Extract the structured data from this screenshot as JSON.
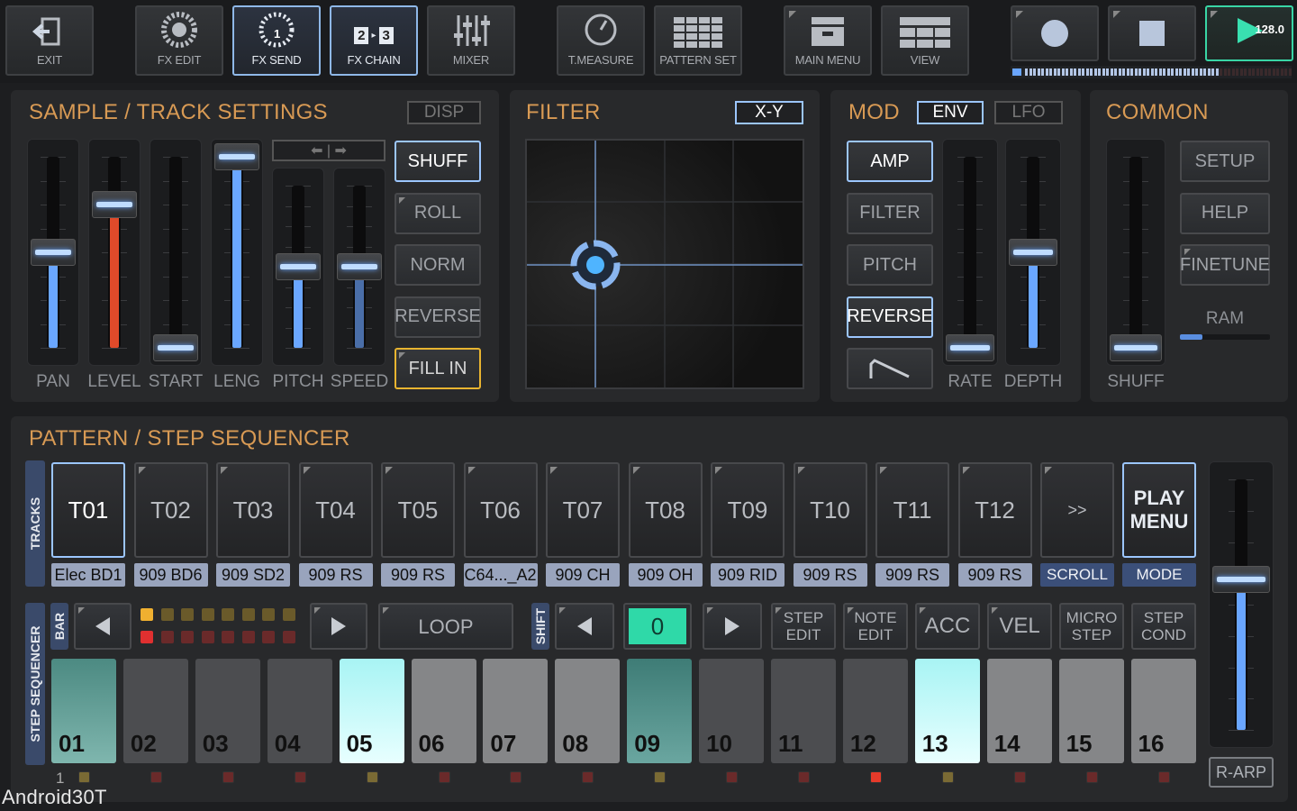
{
  "toolbar": {
    "buttons": [
      {
        "label": "EXIT",
        "icon": "exit-icon"
      },
      {
        "label": "FX EDIT",
        "icon": "fx-edit-icon"
      },
      {
        "label": "FX SEND",
        "icon": "fx-send-icon"
      },
      {
        "label": "FX CHAIN",
        "icon": "fx-chain-icon",
        "chain_a": "2",
        "chain_b": "3"
      },
      {
        "label": "MIXER",
        "icon": "mixer-icon"
      },
      {
        "label": "T.MEASURE",
        "icon": "tempo-icon"
      },
      {
        "label": "PATTERN SET",
        "icon": "grid-icon"
      },
      {
        "label": "MAIN MENU",
        "icon": "drawer-icon"
      },
      {
        "label": "VIEW",
        "icon": "view-icon"
      }
    ],
    "fx_send_badge": "1",
    "transport": {
      "record": "record-icon",
      "stop": "stop-icon",
      "play": "play-icon",
      "bpm": "128.0"
    }
  },
  "sample_panel": {
    "title": "SAMPLE / TRACK SETTINGS",
    "disp": "DISP",
    "arrows": "⬅ | ➡",
    "fader_labels": [
      "PAN",
      "LEVEL",
      "START",
      "LENG",
      "PITCH",
      "SPEED"
    ],
    "fader_levels": [
      0.5,
      0.75,
      0.0,
      1.0,
      0.5,
      0.5
    ],
    "buttons": [
      "SHUFF",
      "ROLL",
      "NORM",
      "REVERSE",
      "FILL IN"
    ]
  },
  "filter_panel": {
    "title": "FILTER",
    "mode": "X-Y"
  },
  "mod_panel": {
    "title": "MOD",
    "tabs": [
      "ENV",
      "LFO"
    ],
    "buttons": [
      "AMP",
      "FILTER",
      "PITCH",
      "REVERSE"
    ],
    "fader_labels": [
      "RATE",
      "DEPTH"
    ],
    "fader_levels": [
      0.0,
      0.5
    ]
  },
  "common_panel": {
    "title": "COMMON",
    "buttons": [
      "SETUP",
      "HELP",
      "FINETUNE"
    ],
    "ram": "RAM",
    "ram_level": 0.25,
    "fader_label": "SHUFF",
    "fader_level": 0.0
  },
  "pattern_panel": {
    "title": "PATTERN / STEP SEQUENCER",
    "tracks_tab": "TRACKS",
    "tracks": [
      {
        "id": "T01",
        "name": "Elec BD1"
      },
      {
        "id": "T02",
        "name": "909 BD6"
      },
      {
        "id": "T03",
        "name": "909 SD2"
      },
      {
        "id": "T04",
        "name": "909 RS"
      },
      {
        "id": "T05",
        "name": "909 RS"
      },
      {
        "id": "T06",
        "name": "C64..._A2"
      },
      {
        "id": "T07",
        "name": "909 CH"
      },
      {
        "id": "T08",
        "name": "909 OH"
      },
      {
        "id": "T09",
        "name": "909 RID"
      },
      {
        "id": "T10",
        "name": "909 RS"
      },
      {
        "id": "T11",
        "name": "909 RS"
      },
      {
        "id": "T12",
        "name": "909 RS"
      }
    ],
    "scroll": {
      "label": ">>",
      "caption": "SCROLL"
    },
    "play_menu": {
      "line1": "PLAY",
      "line2": "MENU",
      "caption": "MODE"
    },
    "step_tab": "STEP SEQUENCER",
    "bar_tab": "BAR",
    "shift_tab": "SHIFT",
    "loop": "LOOP",
    "shift_value": "0",
    "controls": [
      {
        "line1": "STEP",
        "line2": "EDIT"
      },
      {
        "line1": "NOTE",
        "line2": "EDIT"
      },
      {
        "line1": "ACC",
        "line2": ""
      },
      {
        "line1": "VEL",
        "line2": ""
      },
      {
        "line1": "MICRO",
        "line2": "STEP"
      },
      {
        "line1": "STEP",
        "line2": "COND"
      }
    ],
    "steps": [
      "01",
      "02",
      "03",
      "04",
      "05",
      "06",
      "07",
      "08",
      "09",
      "10",
      "11",
      "12",
      "13",
      "14",
      "15",
      "16"
    ],
    "bar_number": "1",
    "r_arp": "R-ARP",
    "volume_level": 0.6
  },
  "watermark": "Android30T"
}
